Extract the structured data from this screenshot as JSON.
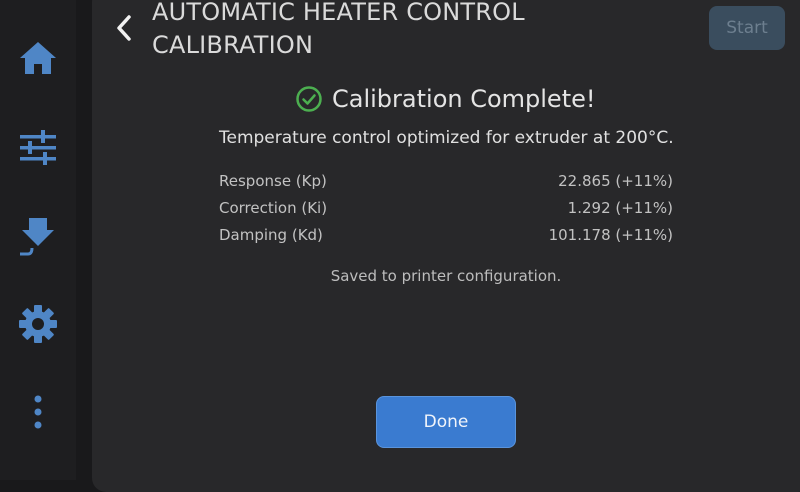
{
  "sidebar": {
    "items": [
      {
        "icon": "home-icon"
      },
      {
        "icon": "sliders-icon"
      },
      {
        "icon": "filament-icon"
      },
      {
        "icon": "gear-icon"
      },
      {
        "icon": "more-icon"
      }
    ]
  },
  "header": {
    "title": "AUTOMATIC HEATER CONTROL CALIBRATION",
    "start_label": "Start"
  },
  "main": {
    "status": "Calibration Complete!",
    "subtitle": "Temperature control optimized for extruder at 200°C.",
    "params": [
      {
        "label": "Response (Kp)",
        "value": "22.865 (+11%)"
      },
      {
        "label": "Correction (Ki)",
        "value": "1.292 (+11%)"
      },
      {
        "label": "Damping (Kd)",
        "value": "101.178 (+11%)"
      }
    ],
    "saved_note": "Saved to printer configuration.",
    "done_label": "Done"
  },
  "colors": {
    "accent": "#3a7bd0",
    "icon": "#4f86c6",
    "success": "#4caf50"
  }
}
